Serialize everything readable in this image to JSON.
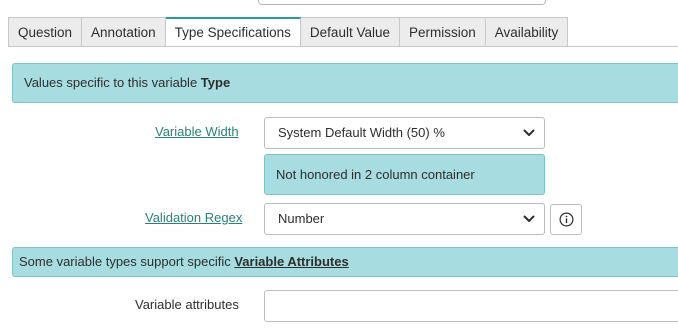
{
  "tabs": [
    {
      "label": "Question",
      "active": false
    },
    {
      "label": "Annotation",
      "active": false
    },
    {
      "label": "Type Specifications",
      "active": true
    },
    {
      "label": "Default Value",
      "active": false
    },
    {
      "label": "Permission",
      "active": false
    },
    {
      "label": "Availability",
      "active": false
    }
  ],
  "type_banner": {
    "text": "Values specific to this variable ",
    "bold": "Type"
  },
  "variable_width": {
    "label": "Variable Width",
    "value": "System Default Width (50) %",
    "note": "Not honored in 2 column container"
  },
  "validation_regex": {
    "label": "Validation Regex",
    "value": "Number",
    "info_icon": "info-circle-icon"
  },
  "attributes_banner": {
    "text": "Some variable types support specific ",
    "link": "Variable Attributes"
  },
  "variable_attributes": {
    "label": "Variable attributes",
    "value": ""
  },
  "colors": {
    "accent": "#2b9a8f",
    "banner_bg": "#a7dde0",
    "link": "#2b8077"
  }
}
